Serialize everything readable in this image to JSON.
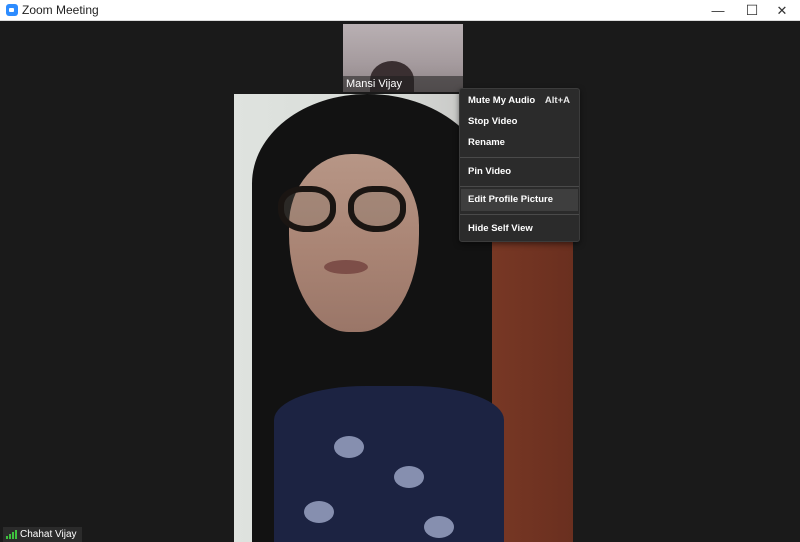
{
  "window": {
    "title": "Zoom Meeting",
    "minimize_glyph": "—",
    "maximize_glyph": "☐",
    "close_glyph": "✕"
  },
  "thumbnail": {
    "participant_name": "Mansi Vijay"
  },
  "main_video": {
    "participant_name": "Chahat Vijay"
  },
  "context_menu": {
    "mute_audio": "Mute My Audio",
    "mute_shortcut": "Alt+A",
    "stop_video": "Stop Video",
    "rename": "Rename",
    "pin_video": "Pin Video",
    "edit_profile_picture": "Edit Profile Picture",
    "hide_self_view": "Hide Self View"
  },
  "colors": {
    "accent": "#2d8cff",
    "signal": "#3ec13e",
    "menu_bg": "#2b2b2b",
    "stage_bg": "#1a1a1a"
  },
  "icons": [
    "zoom-app-icon",
    "signal-strength-icon"
  ]
}
